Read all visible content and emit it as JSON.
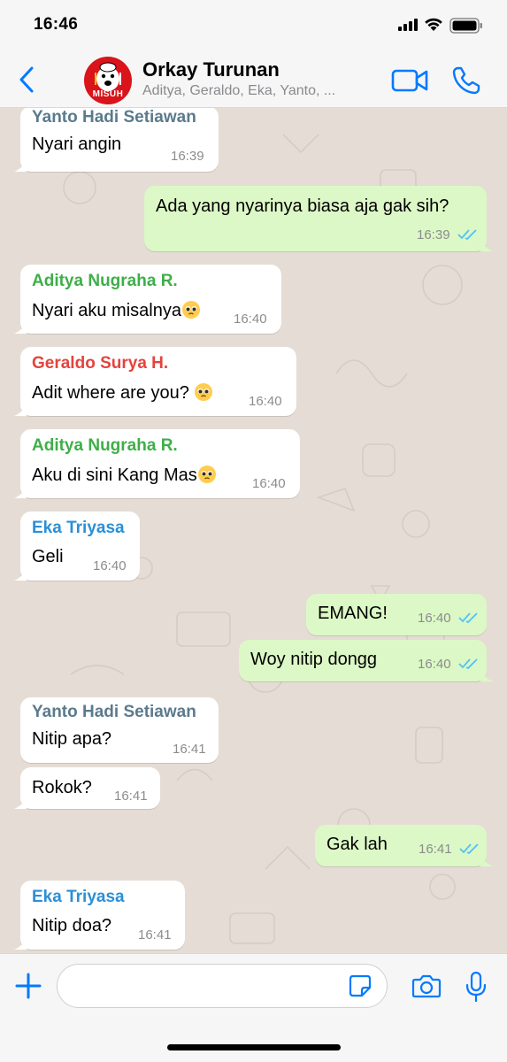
{
  "status_bar": {
    "time": "16:46"
  },
  "header": {
    "title": "Orkay Turunan",
    "members": "Aditya, Geraldo, Eka, Yanto, ...",
    "avatar_text": "MISUH"
  },
  "colors": {
    "accent": "#007aff",
    "outgoing_bubble": "#dcf8c6",
    "incoming_bubble": "#ffffff",
    "read_ticks": "#4fc3f7",
    "sender_yanto": "#5b7a8c",
    "sender_aditya": "#3fae49",
    "sender_geraldo": "#e5433c",
    "sender_eka": "#2b8fd6"
  },
  "messages": [
    {
      "direction": "in",
      "sender": "Yanto Hadi Setiawan",
      "text": "Nyari angin",
      "time": "16:39"
    },
    {
      "direction": "out",
      "text": "Ada yang nyarinya biasa aja gak sih?",
      "time": "16:39",
      "status": "read"
    },
    {
      "direction": "in",
      "sender": "Aditya Nugraha R.",
      "text": "Nyari aku misalnya",
      "emoji": "pleading-face",
      "time": "16:40"
    },
    {
      "direction": "in",
      "sender": "Geraldo Surya H.",
      "text": "Adit where are you? ",
      "emoji": "pleading-face",
      "time": "16:40"
    },
    {
      "direction": "in",
      "sender": "Aditya Nugraha R.",
      "text": "Aku di sini Kang Mas",
      "emoji": "pleading-face",
      "time": "16:40"
    },
    {
      "direction": "in",
      "sender": "Eka Triyasa",
      "text": "Geli",
      "time": "16:40"
    },
    {
      "direction": "out",
      "text": "EMANG!",
      "time": "16:40",
      "status": "read"
    },
    {
      "direction": "out",
      "text": "Woy nitip dongg",
      "time": "16:40",
      "status": "read"
    },
    {
      "direction": "in",
      "sender": "Yanto Hadi Setiawan",
      "text": "Nitip apa?",
      "time": "16:41"
    },
    {
      "direction": "in",
      "text": "Rokok?",
      "time": "16:41"
    },
    {
      "direction": "out",
      "text": "Gak lah",
      "time": "16:41",
      "status": "read"
    },
    {
      "direction": "in",
      "sender": "Eka Triyasa",
      "text": "Nitip doa?",
      "time": "16:41"
    }
  ],
  "composer": {
    "value": "",
    "placeholder": ""
  }
}
